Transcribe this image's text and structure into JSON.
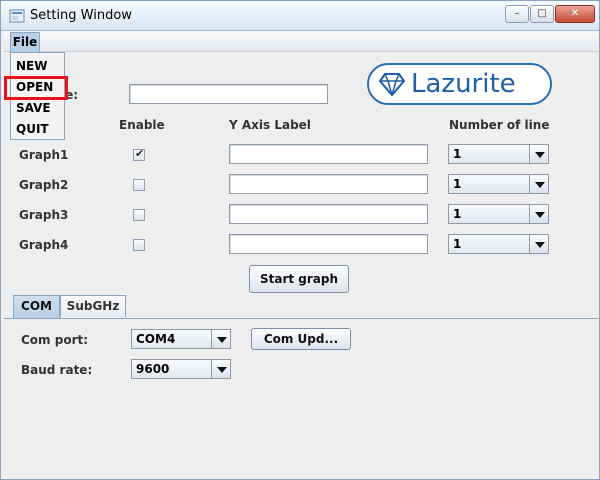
{
  "window": {
    "title": "Setting Window",
    "controls": {
      "minimize": "–",
      "maximize": "□",
      "close": "✕"
    }
  },
  "menubar": {
    "file_label": "File"
  },
  "file_menu": {
    "items": [
      "NEW",
      "OPEN",
      "SAVE",
      "QUIT"
    ],
    "highlighted": "OPEN"
  },
  "logo": {
    "text": "Lazurite",
    "icon": "diamond-icon",
    "color": "#1f5ea8"
  },
  "form": {
    "title_label_partial": "le:",
    "title_value": "",
    "headers": {
      "enable": "Enable",
      "y_axis": "Y Axis Label",
      "lines": "Number of line"
    },
    "graphs": [
      {
        "label": "Graph1",
        "enabled": true,
        "y_label": "",
        "lines": "1"
      },
      {
        "label": "Graph2",
        "enabled": false,
        "y_label": "",
        "lines": "1"
      },
      {
        "label": "Graph3",
        "enabled": false,
        "y_label": "",
        "lines": "1"
      },
      {
        "label": "Graph4",
        "enabled": false,
        "y_label": "",
        "lines": "1"
      }
    ],
    "start_button": "Start graph"
  },
  "tabs": [
    {
      "label": "COM",
      "active": true
    },
    {
      "label": "SubGHz",
      "active": false
    }
  ],
  "com": {
    "port_label": "Com port:",
    "port_value": "COM4",
    "update_button": "Com Upd...",
    "baud_label": "Baud rate:",
    "baud_value": "9600"
  },
  "colors": {
    "highlight_box": "#e5141b",
    "accent": "#b8cfe5"
  }
}
